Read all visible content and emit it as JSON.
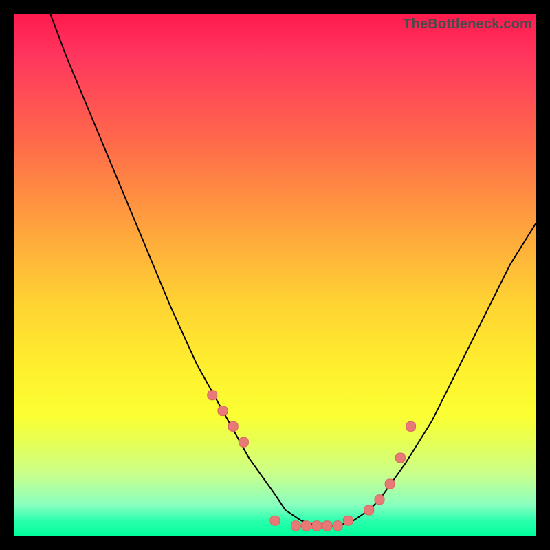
{
  "watermark": {
    "text": "TheBottleneck.com"
  },
  "colors": {
    "gradient_top": "#ff1a4d",
    "gradient_mid": "#fff02e",
    "gradient_bottom": "#00ff9c",
    "curve_stroke": "#000000",
    "marker_fill": "#e77a76",
    "marker_stroke": "#d9635f"
  },
  "chart_data": {
    "type": "line",
    "title": "",
    "xlabel": "",
    "ylabel": "",
    "xlim": [
      0,
      100
    ],
    "ylim": [
      0,
      100
    ],
    "grid": false,
    "legend": false,
    "series": [
      {
        "name": "bottleneck-curve",
        "x": [
          7,
          10,
          15,
          20,
          25,
          30,
          35,
          40,
          45,
          50,
          52,
          55,
          58,
          60,
          62,
          65,
          68,
          70,
          75,
          80,
          85,
          90,
          95,
          100
        ],
        "y": [
          100,
          92,
          80,
          68,
          56,
          44,
          33,
          24,
          15,
          8,
          5,
          3,
          2,
          2,
          2,
          3,
          5,
          7,
          14,
          22,
          32,
          42,
          52,
          60
        ]
      }
    ],
    "markers": {
      "name": "highlight-dots",
      "x": [
        38,
        40,
        42,
        44,
        50,
        54,
        56,
        58,
        60,
        62,
        64,
        68,
        70,
        72,
        74,
        76
      ],
      "y": [
        27,
        24,
        21,
        18,
        3,
        2,
        2,
        2,
        2,
        2,
        3,
        5,
        7,
        10,
        15,
        21
      ]
    }
  }
}
